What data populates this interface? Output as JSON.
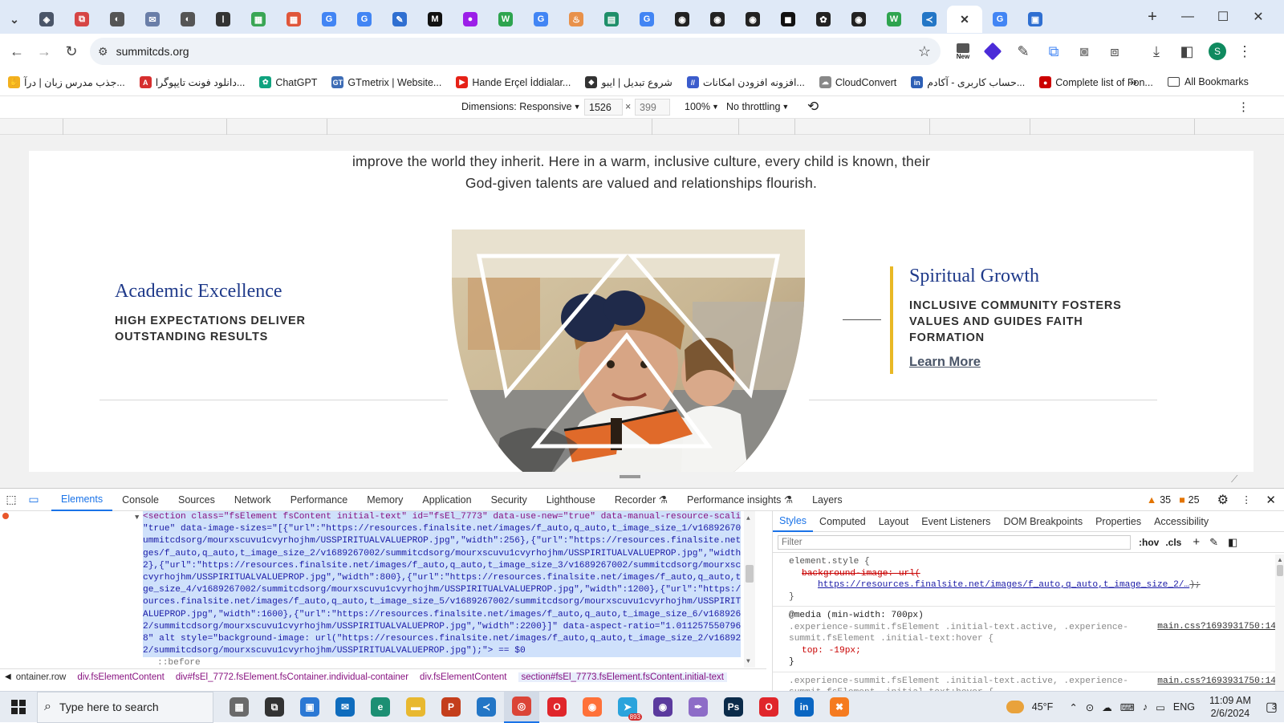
{
  "browser": {
    "tabs": [
      {
        "icon": "chevron-down-icon",
        "color": "#3b3b3b",
        "glyph": "⌄"
      },
      {
        "icon": "shield-icon",
        "color": "#4a5568",
        "glyph": "◈"
      },
      {
        "icon": "puzzle-icon",
        "color": "#d64545",
        "glyph": "⧉"
      },
      {
        "icon": "globe-icon",
        "color": "#555",
        "glyph": "◐"
      },
      {
        "icon": "mail-icon",
        "color": "#6a7ea8",
        "glyph": "✉"
      },
      {
        "icon": "globe-icon",
        "color": "#555",
        "glyph": "◐"
      },
      {
        "icon": "site-icon",
        "color": "#333",
        "glyph": "ا"
      },
      {
        "icon": "grid-icon",
        "color": "#3aa655",
        "glyph": "▦"
      },
      {
        "icon": "grid-icon",
        "color": "#e0563a",
        "glyph": "▦"
      },
      {
        "icon": "google-icon",
        "color": "#4285f4",
        "glyph": "G"
      },
      {
        "icon": "google-icon",
        "color": "#4285f4",
        "glyph": "G"
      },
      {
        "icon": "app-icon",
        "color": "#2f6fd1",
        "glyph": "✎"
      },
      {
        "icon": "medium-icon",
        "color": "#111",
        "glyph": "M"
      },
      {
        "icon": "circle-icon",
        "color": "#9b1fe8",
        "glyph": "●"
      },
      {
        "icon": "wordtune-icon",
        "color": "#2ea44f",
        "glyph": "W"
      },
      {
        "icon": "google-icon",
        "color": "#4285f4",
        "glyph": "G"
      },
      {
        "icon": "hand-icon",
        "color": "#e8914a",
        "glyph": "♨"
      },
      {
        "icon": "doc-icon",
        "color": "#1f8f6a",
        "glyph": "▤"
      },
      {
        "icon": "google-icon",
        "color": "#4285f4",
        "glyph": "G"
      },
      {
        "icon": "github-icon",
        "color": "#222",
        "glyph": "◉"
      },
      {
        "icon": "github-icon",
        "color": "#222",
        "glyph": "◉"
      },
      {
        "icon": "github-icon",
        "color": "#222",
        "glyph": "◉"
      },
      {
        "icon": "ai-icon",
        "color": "#111",
        "glyph": "◼"
      },
      {
        "icon": "openai-icon",
        "color": "#222",
        "glyph": "✿"
      },
      {
        "icon": "github-icon",
        "color": "#222",
        "glyph": "◉"
      },
      {
        "icon": "wordtune-icon",
        "color": "#2ea44f",
        "glyph": "W"
      },
      {
        "icon": "vscode-icon",
        "color": "#2376c6",
        "glyph": "≺"
      },
      {
        "icon": "close-icon",
        "color": "#333",
        "glyph": "✕",
        "active": true
      },
      {
        "icon": "google-icon",
        "color": "#4285f4",
        "glyph": "G"
      },
      {
        "icon": "forms-icon",
        "color": "#2f6fd1",
        "glyph": "▣"
      }
    ],
    "new_tab": "+",
    "window_controls": {
      "minimize": "—",
      "maximize": "☐",
      "close": "✕"
    },
    "url": "summitcds.org",
    "new_badge": "New",
    "profile_initial": "S",
    "bookmarks": [
      {
        "label": "جذب مدرس زبان | درآ...",
        "color": "#f2b01e",
        "glyph": "✋"
      },
      {
        "label": "دانلود فونت تایپوگرا...",
        "color": "#d62e2e",
        "glyph": "A"
      },
      {
        "label": "ChatGPT",
        "color": "#10a37f",
        "glyph": "✿"
      },
      {
        "label": "GTmetrix | Website...",
        "color": "#3d6cb5",
        "glyph": "GT"
      },
      {
        "label": "Hande Erçel İddialar...",
        "color": "#e62117",
        "glyph": "▶"
      },
      {
        "label": "شروع تبدیل | ایبو",
        "color": "#333",
        "glyph": "◆"
      },
      {
        "label": "افزونه افزودن امکانات...",
        "color": "#3b5ccc",
        "glyph": "//"
      },
      {
        "label": "CloudConvert",
        "color": "#888",
        "glyph": "☁"
      },
      {
        "label": "حساب کاربری - آکادم...",
        "color": "#2d5fb5",
        "glyph": "in"
      },
      {
        "label": "Complete list of Fon...",
        "color": "#c00",
        "glyph": "●"
      }
    ],
    "all_bookmarks": "All Bookmarks",
    "more_bookmarks": "»"
  },
  "device_toolbar": {
    "dimensions_label": "Dimensions: Responsive",
    "width": "1526",
    "times": "×",
    "height": "399",
    "zoom": "100%",
    "throttling": "No throttling"
  },
  "page": {
    "intro_line1": "improve the world they inherit. Here in a warm, inclusive culture, every child is known, their",
    "intro_line2": "God-given talents are valued and relationships flourish.",
    "left_title": "Academic Excellence",
    "left_subtitle": "HIGH EXPECTATIONS DELIVER OUTSTANDING RESULTS",
    "right_title": "Spiritual Growth",
    "right_subtitle": "INCLUSIVE COMMUNITY FOSTERS VALUES AND GUIDES FAITH FORMATION",
    "right_link": "Learn More",
    "colors": {
      "navy": "#1f3a8a",
      "gold": "#e9b825",
      "text": "#2f2f2f"
    }
  },
  "devtools": {
    "tabs": [
      "Elements",
      "Console",
      "Sources",
      "Network",
      "Performance",
      "Memory",
      "Application",
      "Security",
      "Lighthouse",
      "Recorder ⚗",
      "Performance insights ⚗",
      "Layers"
    ],
    "active_tab": "Elements",
    "warnings": "35",
    "issues": "25",
    "dom_lines": [
      "<section class=\"fsElement fsContent initial-text\" id=\"fsEl_7773\" data-use-new=\"true\" data-manual-resource-scaling=",
      "\"true\" data-image-sizes=\"[{\"url\":\"https://resources.finalsite.net/images/f_auto,q_auto,t_image_size_1/v1689267002/s",
      "ummitcdsorg/mourxscuvu1cvyrhojhm/USSPIRITUALVALUEPROP.jpg\",\"width\":256},{\"url\":\"https://resources.finalsite.net/ima",
      "ges/f_auto,q_auto,t_image_size_2/v1689267002/summitcdsorg/mourxscuvu1cvyrhojhm/USSPIRITUALVALUEPROP.jpg\",\"width\":51",
      "2},{\"url\":\"https://resources.finalsite.net/images/f_auto,q_auto,t_image_size_3/v1689267002/summitcdsorg/mourxscuvu1",
      "cvyrhojhm/USSPIRITUALVALUEPROP.jpg\",\"width\":800},{\"url\":\"https://resources.finalsite.net/images/f_auto,q_auto,t_ima",
      "ge_size_4/v1689267002/summitcdsorg/mourxscuvu1cvyrhojhm/USSPIRITUALVALUEPROP.jpg\",\"width\":1200},{\"url\":\"https://res",
      "ources.finalsite.net/images/f_auto,q_auto,t_image_size_5/v1689267002/summitcdsorg/mourxscuvu1cvyrhojhm/USSPIRITUAL",
      "ALUEPROP.jpg\",\"width\":1600},{\"url\":\"https://resources.finalsite.net/images/f_auto,q_auto,t_image_size_6/v168926700",
      "2/summitcdsorg/mourxscuvu1cvyrhojhm/USSPIRITUALVALUEPROP.jpg\",\"width\":2200}]\" data-aspect-ratio=\"1.011257550796265",
      "8\" alt style=\"background-image: url(\"https://resources.finalsite.net/images/f_auto,q_auto,t_image_size_2/v168926700",
      "2/summitcdsorg/mourxscuvu1cvyrhojhm/USSPIRITUALVALUEPROP.jpg\");\"> == $0",
      "::before"
    ],
    "breadcrumbs": [
      "ontainer.row",
      "div.fsElementContent",
      "div#fsEl_7772.fsElement.fsContainer.individual-container",
      "div.fsElementContent",
      "section#fsEl_7773.fsElement.fsContent.initial-text"
    ],
    "style_tabs": [
      "Styles",
      "Computed",
      "Layout",
      "Event Listeners",
      "DOM Breakpoints",
      "Properties",
      "Accessibility"
    ],
    "filter_placeholder": "Filter",
    "hov": ":hov",
    "cls": ".cls",
    "element_style": "element.style {",
    "bg_prop": "background-image: url(",
    "bg_url": "https://resources.finalsite.net/images/f_auto,q_auto,t_image_size_2/…",
    "bg_end": ");",
    "close_brace": "}",
    "media": "@media (min-width: 700px)",
    "rule1_sel": ".experience-summit.fsElement .initial-text.active, .experience-summit.fsElement .initial-text:hover {",
    "rule1_source": "main.css?1693931750:14",
    "rule1_prop": "top: -19px;",
    "rule2_sel": ".experience-summit.fsElement .initial-text.active, .experience-summit.fsElement .initial-text:hover {",
    "rule2_source": "main.css?1693931750:14"
  },
  "taskbar": {
    "search_placeholder": "Type here to search",
    "apps": [
      {
        "icon": "calculator-icon",
        "color": "#6a6a6a",
        "glyph": "▦"
      },
      {
        "icon": "task-view-icon",
        "color": "#333",
        "glyph": "⧉"
      },
      {
        "icon": "store-icon",
        "color": "#2b78d4",
        "glyph": "▣"
      },
      {
        "icon": "mail-icon",
        "color": "#0f6cbd",
        "glyph": "✉"
      },
      {
        "icon": "edge-icon",
        "color": "#1c8f73",
        "glyph": "e"
      },
      {
        "icon": "folder-icon",
        "color": "#e8b830",
        "glyph": "▬"
      },
      {
        "icon": "powerpoint-icon",
        "color": "#c43e1c",
        "glyph": "P"
      },
      {
        "icon": "vscode-icon",
        "color": "#2376c6",
        "glyph": "≺"
      },
      {
        "icon": "chrome-icon",
        "color": "#db4437",
        "glyph": "◎"
      },
      {
        "icon": "opera-icon",
        "color": "#e0262b",
        "glyph": "O"
      },
      {
        "icon": "firefox-icon",
        "color": "#ff7139",
        "glyph": "◉"
      },
      {
        "icon": "telegram-icon",
        "color": "#2aa3dc",
        "glyph": "➤"
      },
      {
        "icon": "github-icon",
        "color": "#5b3a9e",
        "glyph": "◉"
      },
      {
        "icon": "feather-icon",
        "color": "#8d6cc7",
        "glyph": "✒"
      },
      {
        "icon": "photoshop-icon",
        "color": "#0b2b4a",
        "glyph": "Ps"
      },
      {
        "icon": "opera-gx-icon",
        "color": "#e0262b",
        "glyph": "O"
      },
      {
        "icon": "linkedin-icon",
        "color": "#0a66c2",
        "glyph": "in"
      },
      {
        "icon": "xampp-icon",
        "color": "#f57b20",
        "glyph": "✖"
      }
    ],
    "telegram_badge": "893",
    "temperature": "45°F",
    "language": "ENG",
    "time": "11:09 AM",
    "date": "2/6/2024",
    "notifications": "3"
  }
}
